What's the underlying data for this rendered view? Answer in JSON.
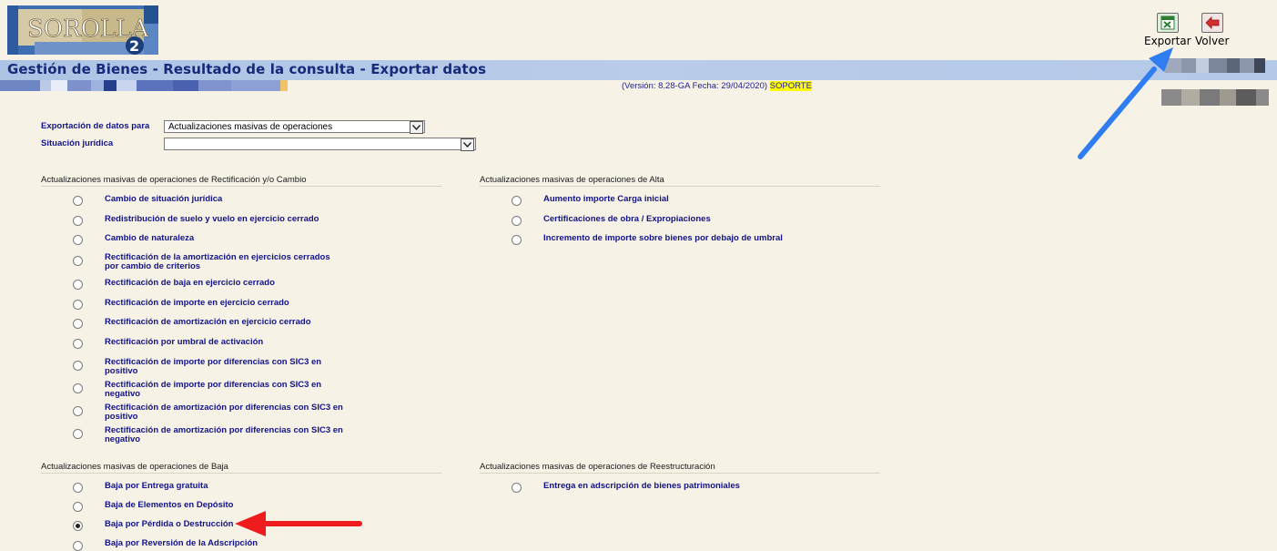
{
  "app": {
    "logo_text": "SOROLLA",
    "logo_number": "2"
  },
  "toolbar": {
    "export_label": "Exportar",
    "back_label": "Volver"
  },
  "header": {
    "title": "Gestión de Bienes - Resultado de la consulta - Exportar datos",
    "version_text": "(Versión: 8.28-GA Fecha: 29/04/2020)",
    "support_text": "SOPORTE"
  },
  "form": {
    "export_label": "Exportación de datos para",
    "export_value": "Actualizaciones masivas de operaciones",
    "situation_label": "Situación jurídica",
    "situation_value": ""
  },
  "sections": {
    "rectificacion": {
      "title": "Actualizaciones masivas de operaciones de Rectificación y/o Cambio",
      "options": [
        "Cambio de situación jurídica",
        "Redistribución de suelo y vuelo en ejercicio cerrado",
        "Cambio de naturaleza",
        "Rectificación de la amortización en ejercicios cerrados por cambio de criterios",
        "Rectificación de baja en ejercicio cerrado",
        "Rectificación de importe en ejercicio cerrado",
        "Rectificación de amortización en ejercicio cerrado",
        "Rectificación por umbral de activación",
        "Rectificación de importe por diferencias con SIC3 en positivo",
        "Rectificación de importe por diferencias con SIC3 en negativo",
        "Rectificación de amortización por diferencias con SIC3 en positivo",
        "Rectificación de amortización por diferencias con SIC3 en negativo"
      ]
    },
    "alta": {
      "title": "Actualizaciones masivas de operaciones de Alta",
      "options": [
        "Aumento importe Carga inicial",
        "Certificaciones de obra / Expropiaciones",
        "Incremento de importe sobre bienes por debajo de umbral"
      ]
    },
    "baja": {
      "title": "Actualizaciones masivas de operaciones de Baja",
      "options": [
        "Baja por Entrega gratuita",
        "Baja de Elementos en Depósito",
        "Baja por Pérdida o Destrucción",
        "Baja por Reversión de la Adscripción"
      ],
      "selected": "Baja por Pérdida o Destrucción"
    },
    "reestructuracion": {
      "title": "Actualizaciones masivas de operaciones de Reestructuración",
      "options": [
        "Entrega en adscripción de bienes patrimoniales"
      ]
    }
  },
  "colors": {
    "title_text": "#17297a",
    "label_text": "#12128a",
    "background": "#f6f3e6",
    "title_band": "#b4c8e8",
    "highlight": "#ffff00",
    "annotation_blue": "#2f7df0",
    "annotation_red": "#ee1c1c"
  },
  "icons": {
    "export": "excel-export-icon",
    "back": "back-arrow-icon"
  }
}
